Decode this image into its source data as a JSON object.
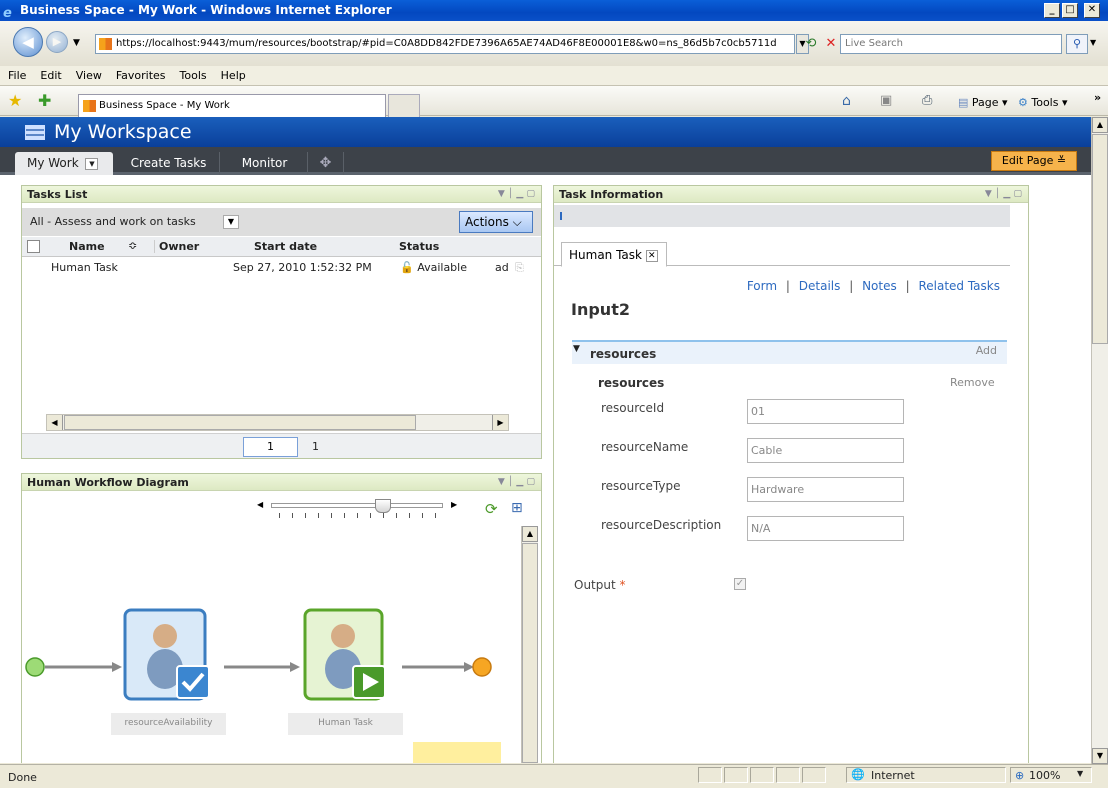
{
  "window": {
    "title": "Business Space - My Work - Windows Internet Explorer",
    "min_glyph": "_",
    "max_glyph": "□",
    "close_glyph": "✕"
  },
  "address": {
    "url": "https://localhost:9443/mum/resources/bootstrap/#pid=C0A8DD842FDE7396A65AE74AD46F8E00001E8&w0=ns_86d5b7c0cb5711d",
    "search_placeholder": "Live Search"
  },
  "menu": [
    "File",
    "Edit",
    "View",
    "Favorites",
    "Tools",
    "Help"
  ],
  "browser_tab": {
    "label": "Business Space - My Work"
  },
  "command_bar": {
    "page_label": "Page",
    "tools_label": "Tools"
  },
  "workspace": {
    "title": "My Workspace",
    "tabs": [
      "My Work",
      "Create Tasks",
      "Monitor"
    ],
    "edit_page_label": "Edit Page"
  },
  "tasks_list": {
    "title": "Tasks List",
    "filter_label": "All - Assess and work on tasks",
    "actions_label": "Actions",
    "columns": [
      "Name",
      "Owner",
      "Start date",
      "Status"
    ],
    "rows": [
      {
        "name": "Human Task",
        "owner": "",
        "start_date": "Sep 27, 2010 1:52:32 PM",
        "status": "Available",
        "extra": "ad"
      }
    ],
    "page_input": "1",
    "page_total": "1"
  },
  "workflow": {
    "title": "Human Workflow Diagram",
    "nodes": [
      "resourceAvailability",
      "Human Task"
    ],
    "zoom_level": 0.65
  },
  "task_info": {
    "title": "Task Information",
    "tab_label": "Human Task",
    "links": [
      "Form",
      "Details",
      "Notes",
      "Related Tasks"
    ],
    "separator": "|",
    "form_title": "Input2",
    "section_label": "resources",
    "add_label": "Add",
    "subsection_label": "resources",
    "remove_label": "Remove",
    "fields": [
      {
        "label": "resourceId",
        "value": "01"
      },
      {
        "label": "resourceName",
        "value": "Cable"
      },
      {
        "label": "resourceType",
        "value": "Hardware"
      },
      {
        "label": "resourceDescription",
        "value": "N/A"
      }
    ],
    "output_label": "Output",
    "required_marker": "*",
    "output_checked": true
  },
  "status": {
    "left": "Done",
    "zone": "Internet",
    "zoom": "100%"
  },
  "colors": {
    "accent_blue": "#0a3f9a",
    "edit_orange": "#f6b34b",
    "portlet_head": "#dde9c3",
    "start_node": "#8fd16a",
    "end_node": "#f5a623"
  }
}
